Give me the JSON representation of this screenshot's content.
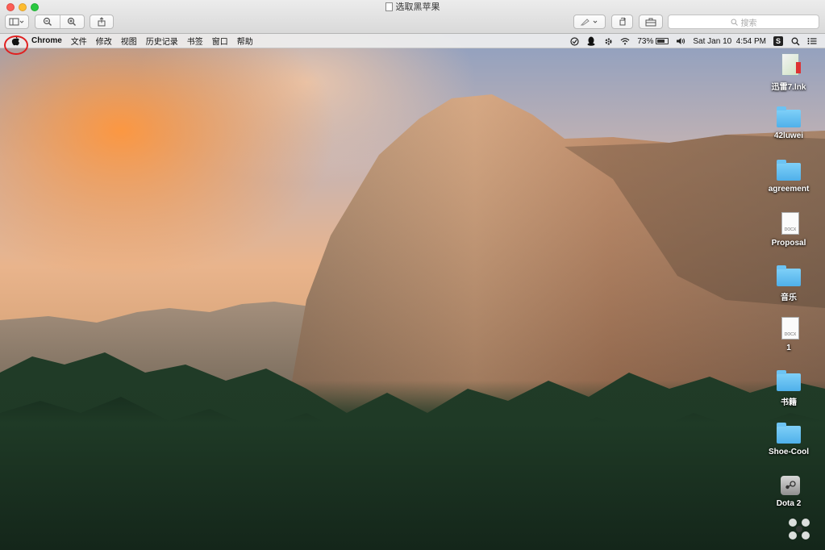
{
  "window": {
    "title": "选取黑苹果",
    "search_placeholder": "搜索"
  },
  "menubar": {
    "apple": "",
    "app_name": "Chrome",
    "items": [
      "文件",
      "修改",
      "视图",
      "历史记录",
      "书签",
      "窗口",
      "帮助"
    ],
    "battery_percent": "73%",
    "battery_level": 0.73,
    "clock": "Sat Jan 10  4:54 PM",
    "s_badge": "S"
  },
  "desktop_icons": [
    {
      "label": "迅雷7.lnk",
      "kind": "lnk-icon"
    },
    {
      "label": "42luwei",
      "kind": "folder-icon"
    },
    {
      "label": "agreement",
      "kind": "folder-icon"
    },
    {
      "label": "Proposal",
      "kind": "document-icon",
      "badge": "DOCX"
    },
    {
      "label": "音乐",
      "kind": "folder-icon"
    },
    {
      "label": "1",
      "kind": "document-icon",
      "badge": "DOCX"
    },
    {
      "label": "书籍",
      "kind": "folder-icon"
    },
    {
      "label": "Shoe-Cool",
      "kind": "folder-icon"
    },
    {
      "label": "Dota 2",
      "kind": "steam-icon"
    }
  ]
}
